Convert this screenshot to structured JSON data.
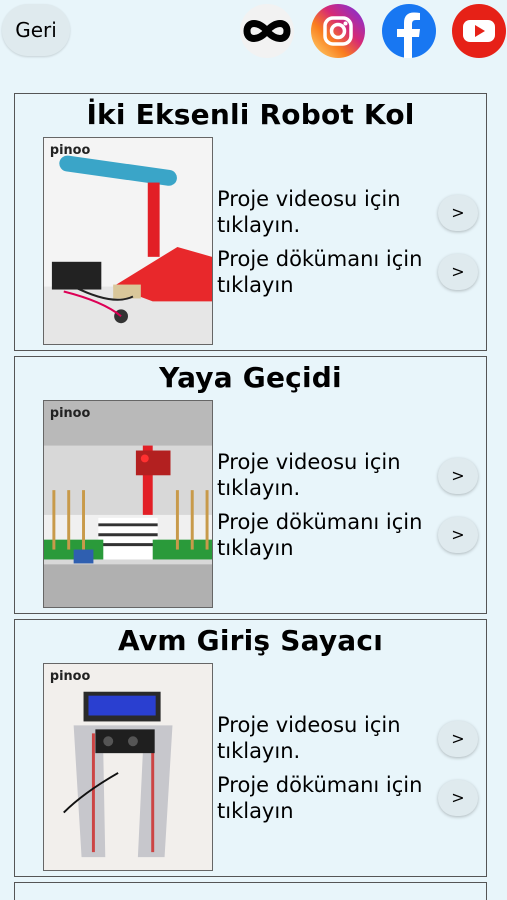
{
  "header": {
    "back_label": "Geri",
    "social_icons": [
      "pinoo-icon",
      "instagram-icon",
      "facebook-icon",
      "youtube-icon"
    ]
  },
  "projects": [
    {
      "title": "İki Eksenli Robot Kol",
      "thumb_brand": "pinoo",
      "video_text": "Proje videosu için tıklayın.",
      "doc_text": "Proje dökümanı için tıklayın",
      "arrow": ">"
    },
    {
      "title": "Yaya Geçidi",
      "thumb_brand": "pinoo",
      "video_text": "Proje videosu için tıklayın.",
      "doc_text": "Proje dökümanı için tıklayın",
      "arrow": ">"
    },
    {
      "title": "Avm Giriş Sayacı",
      "thumb_brand": "pinoo",
      "video_text": "Proje videosu için tıklayın.",
      "doc_text": "Proje dökümanı için tıklayın",
      "arrow": ">"
    }
  ],
  "colors": {
    "background": "#e8f5fa",
    "instagram": "#d62976",
    "facebook": "#1877f2",
    "youtube": "#e62117"
  }
}
